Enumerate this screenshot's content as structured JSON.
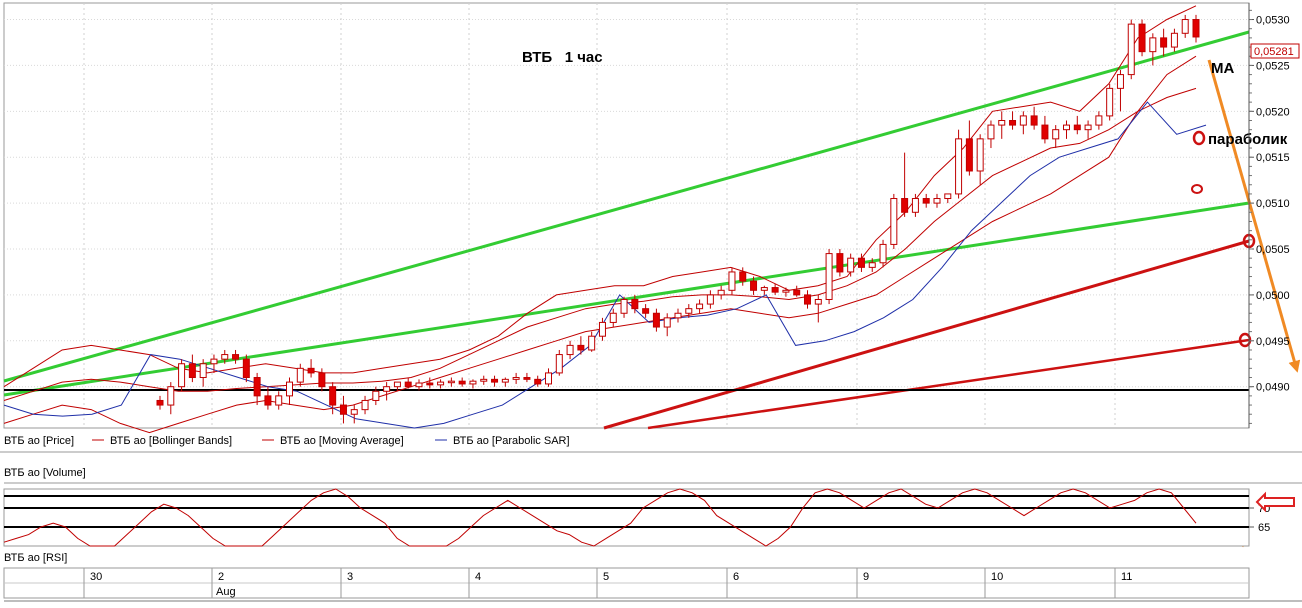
{
  "annotations": {
    "title": "ВТБ   1 час",
    "ma": "МА",
    "parabolic": "параболик"
  },
  "legend": [
    {
      "label": "ВТБ ао [Price]",
      "color": "#c00000"
    },
    {
      "label": "ВТБ ао [Bollinger Bands]",
      "color": "#c00000"
    },
    {
      "label": "ВТБ ао [Moving Average]",
      "color": "#c00000"
    },
    {
      "label": "ВТБ ао [Parabolic SAR]",
      "color": "#1f2fa8"
    }
  ],
  "panes": {
    "volume_label": "ВТБ ао [Volume]",
    "rsi_label": "ВТБ ао [RSI]"
  },
  "price_axis": {
    "ticks": [
      "0,0530",
      "0,0525",
      "0,0520",
      "0,0515",
      "0,0510",
      "0,0505",
      "0,0500",
      "0,0495",
      "0,0490"
    ],
    "current_price": "0,05281"
  },
  "rsi_axis": {
    "ticks": [
      "70",
      "65"
    ]
  },
  "time_axis": {
    "days": [
      "30",
      "2",
      "3",
      "4",
      "5",
      "6",
      "9",
      "10",
      "11"
    ],
    "month": "Aug"
  },
  "colors": {
    "up_candle": "#ffffff",
    "down_candle": "#e00000",
    "indicator": "#c00000",
    "sar": "#1f2fa8",
    "trend_green": "#33cc33",
    "trend_red": "#cc1111",
    "forecast": "#f08a24"
  },
  "chart_data": {
    "type": "candlestick",
    "title": "ВТБ   1 час",
    "ylim": [
      0.04855,
      0.05318
    ],
    "timeframe": "1 час",
    "day_labels": [
      "30",
      "2",
      "3",
      "4",
      "5",
      "6",
      "9",
      "10",
      "11"
    ],
    "month_label": "Aug",
    "last_price": 0.05281,
    "ohlc_approx": [
      [
        0.04885,
        0.0489,
        0.04875,
        0.0488
      ],
      [
        0.0488,
        0.04905,
        0.0487,
        0.049
      ],
      [
        0.049,
        0.0493,
        0.04895,
        0.04925
      ],
      [
        0.04925,
        0.04935,
        0.04905,
        0.0491
      ],
      [
        0.0491,
        0.0493,
        0.049,
        0.04925
      ],
      [
        0.04925,
        0.04935,
        0.04915,
        0.0493
      ],
      [
        0.0493,
        0.0494,
        0.04925,
        0.04935
      ],
      [
        0.04935,
        0.0494,
        0.04925,
        0.0493
      ],
      [
        0.0493,
        0.04935,
        0.04905,
        0.0491
      ],
      [
        0.0491,
        0.04915,
        0.0488,
        0.0489
      ],
      [
        0.0489,
        0.049,
        0.04875,
        0.0488
      ],
      [
        0.0488,
        0.04895,
        0.04875,
        0.0489
      ],
      [
        0.0489,
        0.0491,
        0.0488,
        0.04905
      ],
      [
        0.04905,
        0.04925,
        0.049,
        0.0492
      ],
      [
        0.0492,
        0.0493,
        0.0491,
        0.04915
      ],
      [
        0.04915,
        0.0492,
        0.04895,
        0.049
      ],
      [
        0.049,
        0.04905,
        0.0487,
        0.0488
      ],
      [
        0.0488,
        0.0489,
        0.0486,
        0.0487
      ],
      [
        0.0487,
        0.0488,
        0.0486,
        0.04875
      ],
      [
        0.04875,
        0.0489,
        0.0487,
        0.04885
      ],
      [
        0.04885,
        0.049,
        0.0488,
        0.04895
      ],
      [
        0.04895,
        0.04905,
        0.04885,
        0.049
      ],
      [
        0.049,
        0.04905,
        0.04895,
        0.04905
      ],
      [
        0.04905,
        0.0491,
        0.04898,
        0.049
      ],
      [
        0.049,
        0.04908,
        0.04896,
        0.04904
      ],
      [
        0.04904,
        0.0491,
        0.04898,
        0.04902
      ],
      [
        0.04902,
        0.04908,
        0.04898,
        0.04905
      ],
      [
        0.04905,
        0.0491,
        0.049,
        0.04906
      ],
      [
        0.04906,
        0.0491,
        0.049,
        0.04903
      ],
      [
        0.04903,
        0.04908,
        0.04898,
        0.04906
      ],
      [
        0.04906,
        0.04912,
        0.04902,
        0.04908
      ],
      [
        0.04908,
        0.04912,
        0.049,
        0.04905
      ],
      [
        0.04905,
        0.0491,
        0.049,
        0.04908
      ],
      [
        0.04908,
        0.04915,
        0.04903,
        0.0491
      ],
      [
        0.0491,
        0.04915,
        0.04905,
        0.04908
      ],
      [
        0.04908,
        0.04912,
        0.049,
        0.04903
      ],
      [
        0.04903,
        0.0492,
        0.049,
        0.04915
      ],
      [
        0.04915,
        0.0494,
        0.04912,
        0.04935
      ],
      [
        0.04935,
        0.0495,
        0.0493,
        0.04945
      ],
      [
        0.04945,
        0.04955,
        0.04935,
        0.0494
      ],
      [
        0.0494,
        0.0496,
        0.04938,
        0.04955
      ],
      [
        0.04955,
        0.04975,
        0.0495,
        0.0497
      ],
      [
        0.0497,
        0.04985,
        0.04965,
        0.0498
      ],
      [
        0.0498,
        0.04998,
        0.04975,
        0.04995
      ],
      [
        0.04995,
        0.05,
        0.0498,
        0.04985
      ],
      [
        0.04985,
        0.0499,
        0.04975,
        0.0498
      ],
      [
        0.0498,
        0.04985,
        0.0496,
        0.04965
      ],
      [
        0.04965,
        0.0498,
        0.04955,
        0.04975
      ],
      [
        0.04975,
        0.04985,
        0.0497,
        0.0498
      ],
      [
        0.0498,
        0.0499,
        0.04975,
        0.04985
      ],
      [
        0.04985,
        0.04995,
        0.0498,
        0.0499
      ],
      [
        0.0499,
        0.05005,
        0.04985,
        0.05
      ],
      [
        0.05,
        0.0501,
        0.04995,
        0.05005
      ],
      [
        0.05005,
        0.0503,
        0.05,
        0.05025
      ],
      [
        0.05025,
        0.0503,
        0.0501,
        0.05015
      ],
      [
        0.05015,
        0.0502,
        0.05,
        0.05005
      ],
      [
        0.05005,
        0.0501,
        0.05,
        0.05008
      ],
      [
        0.05008,
        0.05012,
        0.05,
        0.05003
      ],
      [
        0.05003,
        0.05008,
        0.04998,
        0.05005
      ],
      [
        0.05005,
        0.0501,
        0.04998,
        0.05
      ],
      [
        0.05,
        0.05005,
        0.04985,
        0.0499
      ],
      [
        0.0499,
        0.05,
        0.0497,
        0.04995
      ],
      [
        0.04995,
        0.0505,
        0.0499,
        0.05045
      ],
      [
        0.05045,
        0.0505,
        0.0502,
        0.05025
      ],
      [
        0.05025,
        0.05045,
        0.0502,
        0.0504
      ],
      [
        0.0504,
        0.05045,
        0.05025,
        0.0503
      ],
      [
        0.0503,
        0.0504,
        0.05025,
        0.05035
      ],
      [
        0.05035,
        0.0506,
        0.0503,
        0.05055
      ],
      [
        0.05055,
        0.0511,
        0.0505,
        0.05105
      ],
      [
        0.05105,
        0.05155,
        0.05085,
        0.0509
      ],
      [
        0.0509,
        0.0511,
        0.05085,
        0.05105
      ],
      [
        0.05105,
        0.0511,
        0.05095,
        0.051
      ],
      [
        0.051,
        0.0511,
        0.05095,
        0.05105
      ],
      [
        0.05105,
        0.0511,
        0.051,
        0.0511
      ],
      [
        0.0511,
        0.0518,
        0.05105,
        0.0517
      ],
      [
        0.0517,
        0.0519,
        0.0513,
        0.05135
      ],
      [
        0.05135,
        0.05175,
        0.0512,
        0.0517
      ],
      [
        0.0517,
        0.0519,
        0.0516,
        0.05185
      ],
      [
        0.05185,
        0.052,
        0.0517,
        0.0519
      ],
      [
        0.0519,
        0.052,
        0.0518,
        0.05185
      ],
      [
        0.05185,
        0.052,
        0.05175,
        0.05195
      ],
      [
        0.05195,
        0.05205,
        0.0518,
        0.05185
      ],
      [
        0.05185,
        0.05195,
        0.05165,
        0.0517
      ],
      [
        0.0517,
        0.05185,
        0.0516,
        0.0518
      ],
      [
        0.0518,
        0.0519,
        0.0517,
        0.05185
      ],
      [
        0.05185,
        0.05195,
        0.05175,
        0.0518
      ],
      [
        0.0518,
        0.0519,
        0.0517,
        0.05185
      ],
      [
        0.05185,
        0.052,
        0.0518,
        0.05195
      ],
      [
        0.05195,
        0.0523,
        0.0519,
        0.05225
      ],
      [
        0.05225,
        0.05245,
        0.052,
        0.0524
      ],
      [
        0.0524,
        0.053,
        0.05235,
        0.05295
      ],
      [
        0.05295,
        0.053,
        0.0526,
        0.05265
      ],
      [
        0.05265,
        0.05285,
        0.0525,
        0.0528
      ],
      [
        0.0528,
        0.0529,
        0.0526,
        0.0527
      ],
      [
        0.0527,
        0.0529,
        0.05265,
        0.05285
      ],
      [
        0.05285,
        0.05305,
        0.0528,
        0.053
      ],
      [
        0.053,
        0.05305,
        0.05275,
        0.05281
      ]
    ],
    "bollinger_upper": [
      0.049,
      0.0492,
      0.0494,
      0.04945,
      0.0494,
      0.04935,
      0.0492,
      0.04915,
      0.0492,
      0.04925,
      0.0492,
      0.04915,
      0.04915,
      0.0492,
      0.04925,
      0.0493,
      0.0494,
      0.04955,
      0.0498,
      0.05,
      0.05005,
      0.0501,
      0.0501,
      0.0502,
      0.05025,
      0.0503,
      0.0502,
      0.05005,
      0.0501,
      0.0502,
      0.0506,
      0.0509,
      0.0513,
      0.0516,
      0.052,
      0.05205,
      0.0521,
      0.052,
      0.0523,
      0.0528,
      0.053,
      0.05315
    ],
    "bollinger_lower": [
      0.0486,
      0.0487,
      0.0488,
      0.04875,
      0.0486,
      0.0485,
      0.0486,
      0.0487,
      0.0488,
      0.04885,
      0.0488,
      0.04875,
      0.0488,
      0.0489,
      0.049,
      0.0491,
      0.0492,
      0.0493,
      0.0494,
      0.0495,
      0.0496,
      0.04965,
      0.0497,
      0.04975,
      0.0498,
      0.04985,
      0.0498,
      0.04975,
      0.0498,
      0.0499,
      0.05,
      0.0502,
      0.0504,
      0.0506,
      0.0508,
      0.05095,
      0.0511,
      0.0513,
      0.0515,
      0.052,
      0.0524,
      0.0526
    ],
    "moving_average": [
      0.04885,
      0.04895,
      0.04905,
      0.04908,
      0.04905,
      0.049,
      0.04895,
      0.04895,
      0.04898,
      0.049,
      0.04902,
      0.04904,
      0.04904,
      0.04906,
      0.0491,
      0.0492,
      0.04935,
      0.0495,
      0.04965,
      0.04975,
      0.04985,
      0.0499,
      0.04993,
      0.04998,
      0.05,
      0.05,
      0.04998,
      0.04995,
      0.05,
      0.0501,
      0.05025,
      0.0505,
      0.0508,
      0.05105,
      0.0513,
      0.05145,
      0.0516,
      0.05165,
      0.0518,
      0.052,
      0.05215,
      0.05225
    ],
    "parabolic_sar": [
      0.0488,
      0.0487,
      0.04868,
      0.0487,
      0.0488,
      0.04935,
      0.0493,
      0.0492,
      0.0491,
      0.049,
      0.04895,
      0.0488,
      0.04865,
      0.0486,
      0.04855,
      0.0486,
      0.0487,
      0.0488,
      0.049,
      0.0492,
      0.04945,
      0.05,
      0.0497,
      0.04975,
      0.04978,
      0.04985,
      0.05,
      0.04945,
      0.0495,
      0.0496,
      0.04975,
      0.04995,
      0.0503,
      0.0507,
      0.051,
      0.0513,
      0.0515,
      0.0516,
      0.0517,
      0.0521,
      0.05175,
      0.05185
    ],
    "rsi_ylim": [
      60,
      75
    ],
    "rsi_levels": [
      70,
      65
    ],
    "rsi_values": [
      61,
      62,
      63,
      65,
      66,
      65,
      62,
      60,
      58,
      60,
      63,
      66,
      69,
      71,
      70,
      68,
      65,
      62,
      60,
      59,
      58,
      60,
      63,
      66,
      69,
      72,
      74,
      76,
      73,
      70,
      68,
      66,
      62,
      60,
      58,
      57,
      59,
      62,
      65,
      68,
      70,
      72,
      70,
      68,
      66,
      64,
      63,
      61,
      60,
      62,
      64,
      66,
      70,
      72,
      74,
      76,
      74,
      72,
      68,
      66,
      64,
      62,
      60,
      62,
      65,
      70,
      74,
      76,
      74,
      72,
      70,
      72,
      74,
      76,
      73,
      71,
      70,
      72,
      74,
      76,
      74,
      72,
      70,
      68,
      70,
      72,
      74,
      76,
      74,
      72,
      70,
      71,
      72,
      74,
      76,
      74,
      70,
      66
    ]
  }
}
